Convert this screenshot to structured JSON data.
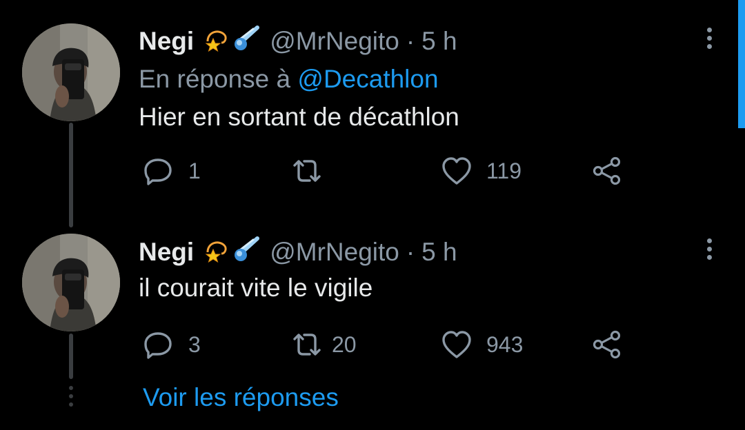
{
  "colors": {
    "background": "#000000",
    "text_primary": "#e7e9ea",
    "text_secondary": "#8b98a5",
    "accent": "#1d9bf0",
    "thread_line": "#3a3d40"
  },
  "tweets": [
    {
      "author_name": "Negi",
      "author_emojis": [
        "dizzy-star-emoji",
        "comet-emoji"
      ],
      "handle": "@MrNegito",
      "separator": "·",
      "time": "5 h",
      "reply_prefix": "En réponse à",
      "reply_mention": "@Decathlon",
      "text": "Hier en sortant de décathlon",
      "replies": "1",
      "retweets": "",
      "likes": "119"
    },
    {
      "author_name": "Negi",
      "author_emojis": [
        "dizzy-star-emoji",
        "comet-emoji"
      ],
      "handle": "@MrNegito",
      "separator": "·",
      "time": "5 h",
      "text": "il courait vite le vigile",
      "replies": "3",
      "retweets": "20",
      "likes": "943"
    }
  ],
  "show_replies_label": "Voir les réponses",
  "icons": {
    "reply": "reply-icon",
    "retweet": "retweet-icon",
    "like": "heart-icon",
    "share": "share-icon",
    "menu": "more-vertical-icon"
  }
}
